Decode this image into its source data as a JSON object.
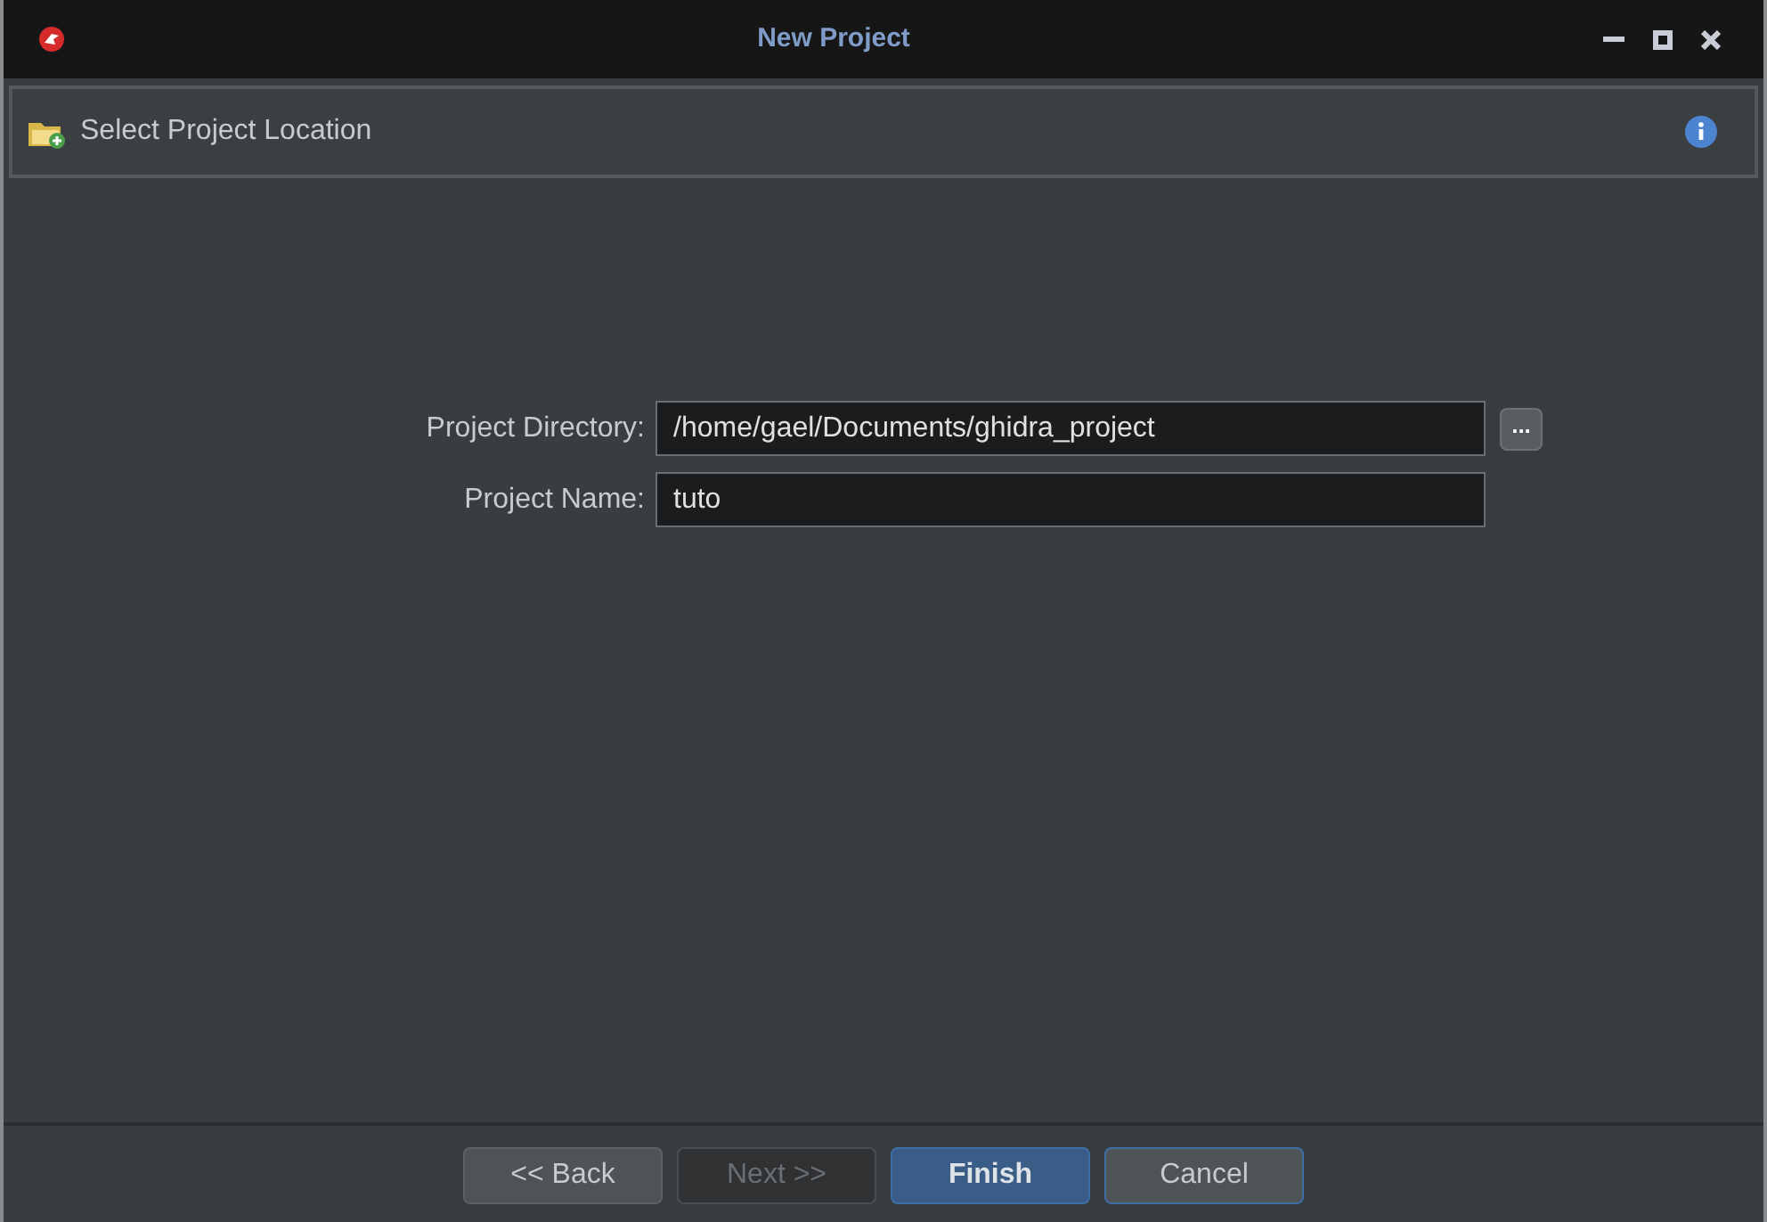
{
  "window": {
    "title": "New Project"
  },
  "header": {
    "title": "Select Project Location"
  },
  "form": {
    "fields": [
      {
        "label": "Project Directory:",
        "value": "/home/gael/Documents/ghidra_project",
        "browse": true
      },
      {
        "label": "Project Name:",
        "value": "tuto",
        "browse": false
      }
    ],
    "browse_label": "..."
  },
  "buttons": [
    {
      "label": "<< Back",
      "disabled": false,
      "default": false,
      "focused": false
    },
    {
      "label": "Next >>",
      "disabled": true,
      "default": false,
      "focused": false
    },
    {
      "label": "Finish",
      "disabled": false,
      "default": true,
      "focused": false
    },
    {
      "label": "Cancel",
      "disabled": false,
      "default": false,
      "focused": true
    }
  ]
}
